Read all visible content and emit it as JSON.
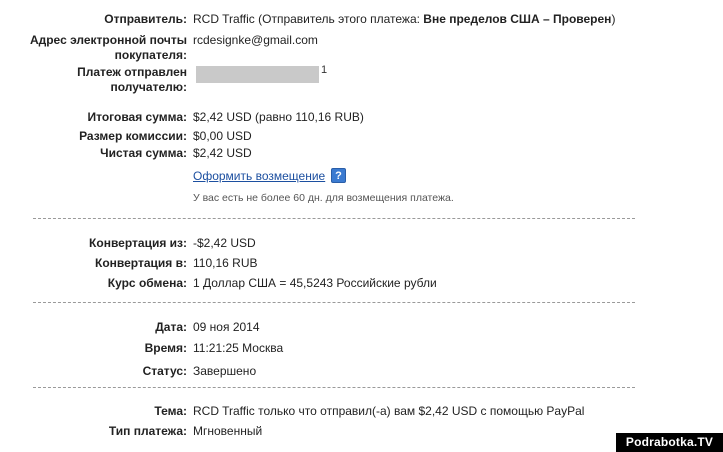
{
  "sender": {
    "label": "Отправитель:",
    "value_plain": "RCD Traffic (Отправитель этого платежа: ",
    "value_bold": "Вне пределов США – Проверен",
    "value_tail": ")"
  },
  "sender_email": {
    "label_line1": "Адрес электронной почты",
    "label_line2": "покупателя:",
    "value": "rcdesignke@gmail.com"
  },
  "recipient": {
    "label_line1": "Платеж отправлен",
    "label_line2": "получателю:",
    "tail": "1"
  },
  "totals": {
    "gross_label": "Итоговая сумма:",
    "gross_value": "$2,42 USD (равно 110,16 RUB)",
    "fee_label": "Размер комиссии:",
    "fee_value": "$0,00 USD",
    "net_label": "Чистая сумма:",
    "net_value": "$2,42 USD"
  },
  "refund": {
    "link": "Оформить возмещение",
    "help": "?",
    "note": "У вас есть не более 60 дн. для возмещения платежа."
  },
  "conversion": {
    "from_label": "Конвертация из:",
    "from_value": "-$2,42 USD",
    "to_label": "Конвертация в:",
    "to_value": "110,16 RUB",
    "rate_label": "Курс обмена:",
    "rate_value": "1 Доллар США = 45,5243 Российские рубли"
  },
  "details": {
    "date_label": "Дата:",
    "date_value": "09 ноя 2014",
    "time_label": "Время:",
    "time_value": "11:21:25 Москва",
    "status_label": "Статус:",
    "status_value": "Завершено"
  },
  "subject": {
    "label": "Тема:",
    "value": "RCD Traffic только что отправил(-а) вам $2,42 USD с помощью PayPal",
    "type_label": "Тип платежа:",
    "type_value": "Мгновенный"
  },
  "watermark": "Podrabotka.TV",
  "colors": {
    "link": "#1c4fa0",
    "help_icon": "#3b7bd1",
    "separator": "#9a9a9a"
  }
}
